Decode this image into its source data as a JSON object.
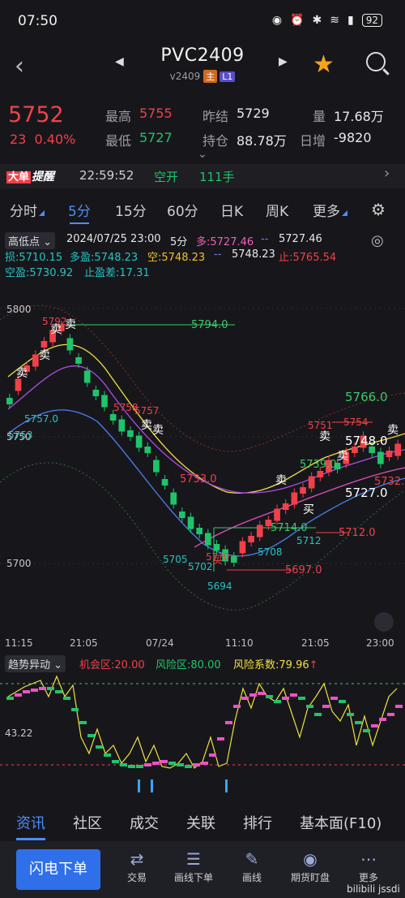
{
  "status": {
    "time": "07:50",
    "battery": "92"
  },
  "header": {
    "title": "PVC2409",
    "contract": "v2409",
    "tag_main": "主",
    "tag_level": "L1"
  },
  "quote": {
    "price": "5752",
    "change": "23",
    "change_pct": "0.40%",
    "high_label": "最高",
    "high": "5755",
    "low_label": "最低",
    "low": "5727",
    "prev_settle_label": "昨结",
    "prev_settle": "5729",
    "open_int_label": "持仓",
    "open_int": "88.78万",
    "volume_label": "量",
    "volume": "17.68万",
    "daily_inc_label": "日增",
    "daily_inc": "-9820"
  },
  "alert": {
    "tag_a": "大单",
    "tag_b": "提醒",
    "time": "22:59:52",
    "action": "空开",
    "amount": "111手"
  },
  "tabs": [
    "分时",
    "5分",
    "15分",
    "60分",
    "日K",
    "周K",
    "更多"
  ],
  "active_tab": 1,
  "legend": {
    "selector": "高低点",
    "datetime": "2024/07/25 23:00",
    "period": "5分",
    "long_label": "多:",
    "long_val": "5727.46",
    "mid_val": "5727.46",
    "stop_loss_label": "损:",
    "stop_loss": "5710.15",
    "long_profit_label": "多盈:",
    "long_profit": "5748.23",
    "short_label": "空:",
    "short_val": "5748.23",
    "mid_val2": "5748.23",
    "stop_label": "止:",
    "stop_val": "5765.54",
    "short_profit_label": "空盈:",
    "short_profit": "5730.92",
    "stop_profit_diff_label": "止盈差:",
    "stop_profit_diff": "17.31"
  },
  "chart_labels": {
    "y_top": "5800",
    "y_mid": "5750",
    "y_bot": "5700",
    "l5794": "5794.0",
    "l5766": "5766.0",
    "l5748": "5748.0",
    "l5727": "5727.0",
    "l5733": "5733.0",
    "l5714": "5714.0",
    "l5712": "5712.0",
    "l5697": "5697.0",
    "l5739": "5739.0",
    "l5732": "5732.",
    "p5757a": "5757.0",
    "p5753": "5753",
    "p5758": "5758",
    "p5757b": "5757",
    "p5705": "5705",
    "p5702": "5702",
    "p5694": "5694",
    "p5708": "5708",
    "p5712b": "5712",
    "p5751": "5751",
    "p5754": "5754",
    "p5792": "5792",
    "p5710": "57?0",
    "sell": "卖",
    "buy": "买",
    "trunc": "卖"
  },
  "time_axis": [
    "11:15",
    "21:05",
    "07/24",
    "11:10",
    "21:05",
    "23:00"
  ],
  "trend": {
    "name": "趋势异动",
    "chance_label": "机会区:",
    "chance": "20.00",
    "risk_label": "风险区:",
    "risk": "80.00",
    "coef_label": "风险系数:",
    "coef": "79.96",
    "y_label": "43.22"
  },
  "bottom_tabs": [
    "资讯",
    "社区",
    "成交",
    "关联",
    "排行",
    "基本面(F10)"
  ],
  "bottom_nav": {
    "flash": "闪电下单",
    "items": [
      "交易",
      "画线下单",
      "画线",
      "期货盯盘",
      "更多"
    ]
  },
  "watermark": "bilibili  jssdi",
  "colors": {
    "up": "#f0414a",
    "down": "#1fc46b",
    "accent": "#4c8df6",
    "bg": "#17171b"
  }
}
